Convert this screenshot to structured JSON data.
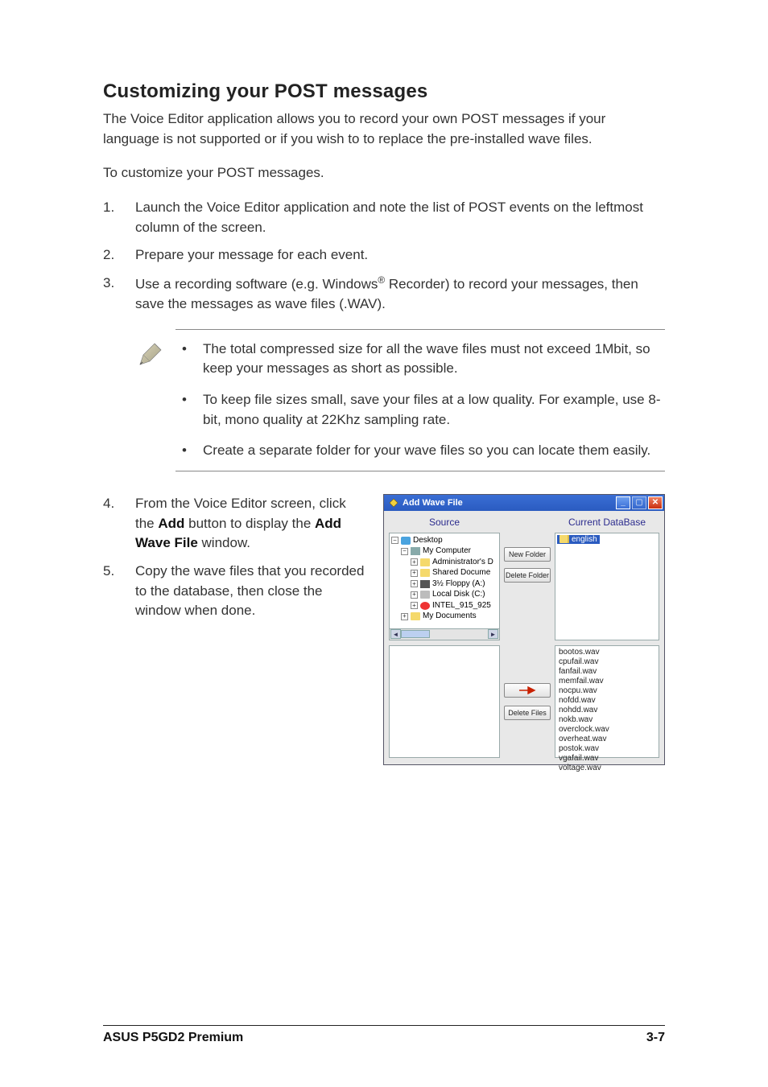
{
  "section": {
    "title": "Customizing your POST messages",
    "intro": "The Voice Editor application allows you to record your own POST messages if your language is not supported or if you wish to  to replace the pre-installed wave files.",
    "lead": "To customize your POST messages."
  },
  "steps_a": [
    {
      "n": "1.",
      "text": "Launch the Voice Editor application and note the list of POST events on the leftmost column of the screen."
    },
    {
      "n": "2.",
      "text": "Prepare your message for each event."
    },
    {
      "n": "3.",
      "text_pre": "Use a recording software (e.g. Windows",
      "sup": "®",
      "text_post": " Recorder) to record your messages, then save the messages as wave files (.WAV)."
    }
  ],
  "notes": [
    "The total compressed size for all the wave files must not exceed 1Mbit, so keep your messages as short as possible.",
    "To keep file sizes small, save your files at a low quality. For example, use 8-bit, mono quality at 22Khz sampling rate.",
    "Create a separate folder for your wave files so you can locate them easily."
  ],
  "steps_b": [
    {
      "n": "4.",
      "pre": "From the Voice Editor screen, click the ",
      "b1": "Add",
      "mid": " button to display the ",
      "b2": "Add Wave File",
      "post": " window."
    },
    {
      "n": "5.",
      "text": "Copy the wave files that you recorded to the database, then close the window when done."
    }
  ],
  "dialog": {
    "title": "Add Wave File",
    "headers": {
      "source": "Source",
      "database": "Current DataBase"
    },
    "buttons": {
      "new_folder": "New Folder",
      "delete_folder": "Delete Folder",
      "delete_files": "Delete Files",
      "move_right": "→"
    },
    "tree": {
      "desktop": "Desktop",
      "my_computer": "My Computer",
      "admin": "Administrator's D",
      "shared": "Shared Docume",
      "floppy": "3½ Floppy (A:)",
      "local": "Local Disk (C:)",
      "intel": "INTEL_915_925",
      "my_docs": "My Documents"
    },
    "selected_folder": "english",
    "db_files": [
      "bootos.wav",
      "cpufail.wav",
      "fanfail.wav",
      "memfail.wav",
      "nocpu.wav",
      "nofdd.wav",
      "nohdd.wav",
      "nokb.wav",
      "overclock.wav",
      "overheat.wav",
      "postok.wav",
      "vgafail.wav",
      "voltage.wav"
    ]
  },
  "footer": {
    "left": "ASUS P5GD2 Premium",
    "right": "3-7"
  }
}
